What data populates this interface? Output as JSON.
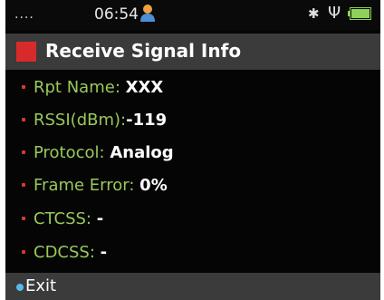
{
  "status_bar": {
    "dots": "....",
    "time": "06:54",
    "icons": [
      "user-icon",
      "bluetooth-icon",
      "usb-icon",
      "battery-icon"
    ]
  },
  "header": {
    "title": "Receive Signal Info",
    "accent_color": "#d82a2a"
  },
  "info": {
    "rows": [
      {
        "label": "Rpt Name:",
        "value": "XXX"
      },
      {
        "label": "RSSI(dBm):",
        "value": "-119"
      },
      {
        "label": "Protocol:",
        "value": "Analog"
      },
      {
        "label": "Frame Error:",
        "value": "0%"
      },
      {
        "label": "CTCSS:",
        "value": "-"
      },
      {
        "label": "CDCSS:",
        "value": "-"
      }
    ],
    "label_color": "#9ac85a",
    "bullet_color": "#d83a2a"
  },
  "footer": {
    "exit_label": "Exit",
    "dot_color": "#59b9e8"
  }
}
